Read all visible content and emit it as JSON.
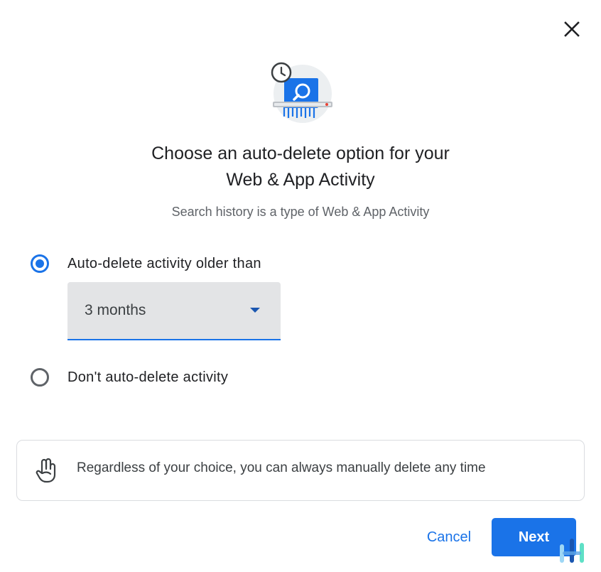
{
  "dialog": {
    "title_line1": "Choose an auto-delete option for your",
    "title_line2": "Web & App Activity",
    "subtitle": "Search history is a type of Web & App Activity",
    "close_icon": "close-icon",
    "illustration_icon": "history-shredder-icon"
  },
  "options": [
    {
      "label": "Auto-delete activity older than",
      "selected": true
    },
    {
      "label": "Don't auto-delete activity",
      "selected": false
    }
  ],
  "select": {
    "value": "3 months",
    "icon": "arrow-drop-down-icon"
  },
  "info": {
    "text": "Regardless of your choice, you can always manually delete any time",
    "icon": "hand-pointing-icon"
  },
  "actions": {
    "cancel_label": "Cancel",
    "next_label": "Next"
  },
  "colors": {
    "accent": "#1a73e8",
    "select_background": "#e3e4e6",
    "text_primary": "#202124",
    "text_secondary": "#5f6368"
  }
}
